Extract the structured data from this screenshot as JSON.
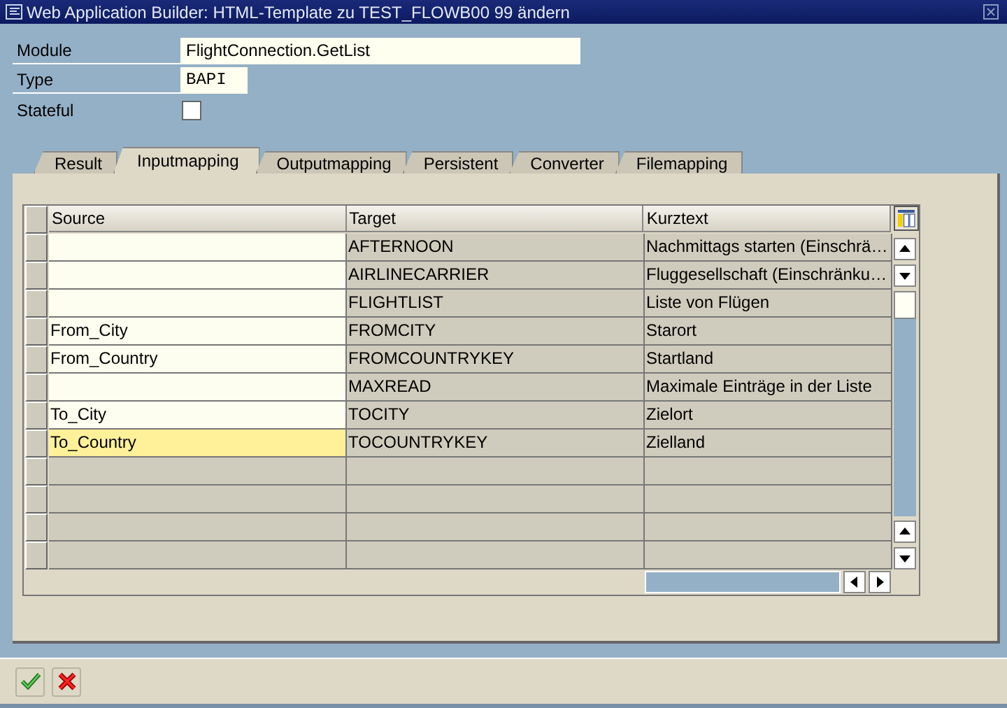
{
  "window": {
    "title": "Web Application Builder: HTML-Template zu TEST_FLOWB00 99 ändern"
  },
  "fields": [
    {
      "label": "Module",
      "value": "FlightConnection.GetList",
      "kind": "text"
    },
    {
      "label": "Type",
      "value": "BAPI",
      "kind": "short"
    },
    {
      "label": "Stateful",
      "checked": false,
      "kind": "checkbox"
    }
  ],
  "tabs": [
    {
      "label": "Result",
      "selected": false
    },
    {
      "label": "Inputmapping",
      "selected": true
    },
    {
      "label": "Outputmapping",
      "selected": false
    },
    {
      "label": "Persistent",
      "selected": false
    },
    {
      "label": "Converter",
      "selected": false
    },
    {
      "label": "Filemapping",
      "selected": false
    }
  ],
  "table": {
    "columns": [
      "Source",
      "Target",
      "Kurztext"
    ],
    "rows": [
      {
        "source": "",
        "target": "AFTERNOON",
        "kurztext": "Nachmittags starten (Einschrä…",
        "focused": false
      },
      {
        "source": "",
        "target": "AIRLINECARRIER",
        "kurztext": "Fluggesellschaft (Einschränku…",
        "focused": false
      },
      {
        "source": "",
        "target": "FLIGHTLIST",
        "kurztext": "Liste von Flügen",
        "focused": false
      },
      {
        "source": "From_City",
        "target": "FROMCITY",
        "kurztext": "Starort",
        "focused": false
      },
      {
        "source": "From_Country",
        "target": "FROMCOUNTRYKEY",
        "kurztext": "Startland",
        "focused": false
      },
      {
        "source": "",
        "target": "MAXREAD",
        "kurztext": "Maximale Einträge in der Liste",
        "focused": false
      },
      {
        "source": "To_City",
        "target": "TOCITY",
        "kurztext": "Zielort",
        "focused": false
      },
      {
        "source": "To_Country",
        "target": "TOCOUNTRYKEY",
        "kurztext": "Zielland",
        "focused": true
      }
    ]
  }
}
